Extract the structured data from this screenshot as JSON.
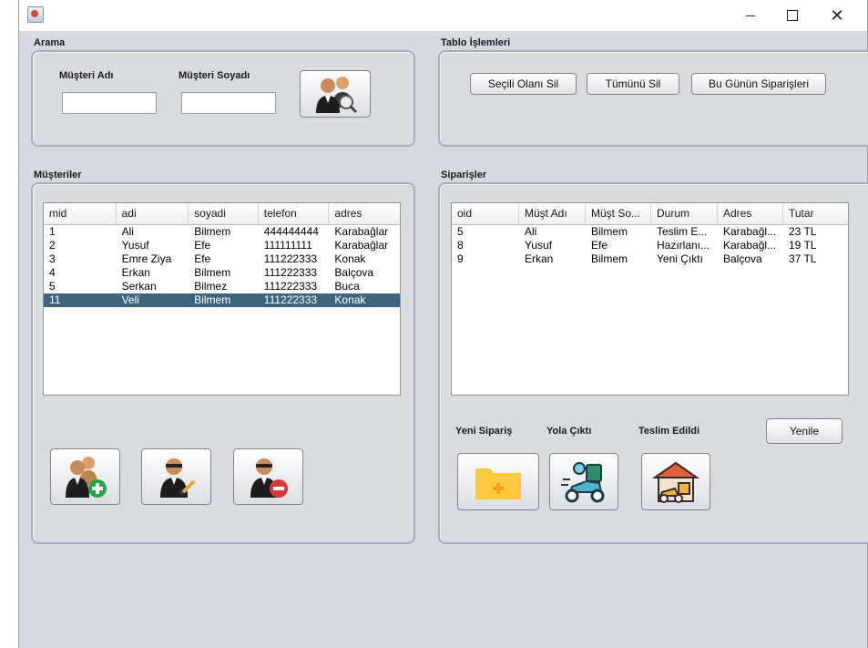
{
  "search": {
    "title": "Arama",
    "first_name_label": "Müşteri Adı",
    "last_name_label": "Müşteri Soyadı",
    "first_name_value": "",
    "last_name_value": ""
  },
  "table_ops": {
    "title": "Tablo İşlemleri",
    "delete_selected": "Seçili Olanı Sil",
    "delete_all": "Tümünü Sil",
    "todays_orders": "Bu Günün Siparişleri"
  },
  "customers": {
    "title": "Müşteriler",
    "columns": [
      "mid",
      "adi",
      "soyadi",
      "telefon",
      "adres"
    ],
    "rows": [
      [
        "1",
        "Ali",
        "Bilmem",
        "444444444",
        "Karabağlar"
      ],
      [
        "2",
        "Yusuf",
        "Efe",
        "111111111",
        "Karabağlar"
      ],
      [
        "3",
        "Emre Ziya",
        "Efe",
        "111222333",
        "Konak"
      ],
      [
        "4",
        "Erkan",
        "Bilmem",
        "111222333",
        "Balçova"
      ],
      [
        "5",
        "Serkan",
        "Bilmez",
        "111222333",
        "Buca"
      ],
      [
        "11",
        "Veli",
        "Bilmem",
        "111222333",
        "Konak"
      ]
    ],
    "selected_row": 5
  },
  "orders": {
    "title": "Siparişler",
    "columns": [
      "oid",
      "Müşt Adı",
      "Müşt So...",
      "Durum",
      "Adres",
      "Tutar"
    ],
    "rows": [
      [
        "5",
        "Ali",
        "Bilmem",
        "Teslim E...",
        "Karabağl...",
        "23 TL"
      ],
      [
        "8",
        "Yusuf",
        "Efe",
        "Hazırlanı...",
        "Karabağl...",
        "19 TL"
      ],
      [
        "9",
        "Erkan",
        "Bilmem",
        "Yeni Çıktı",
        "Balçova",
        "37 TL"
      ]
    ],
    "new_order_label": "Yeni Sipariş",
    "on_the_way_label": "Yola Çıktı",
    "delivered_label": "Teslim Edildi",
    "refresh": "Yenile"
  },
  "colors": {
    "selection": "#3d6580",
    "window_bg": "#d6d9df",
    "folder": "#ffc83d"
  },
  "icons": [
    "app-icon",
    "customer-search-icon",
    "add-customer-icon",
    "edit-customer-icon",
    "delete-customer-icon",
    "new-order-folder-icon",
    "scooter-delivery-icon",
    "delivered-house-icon"
  ]
}
